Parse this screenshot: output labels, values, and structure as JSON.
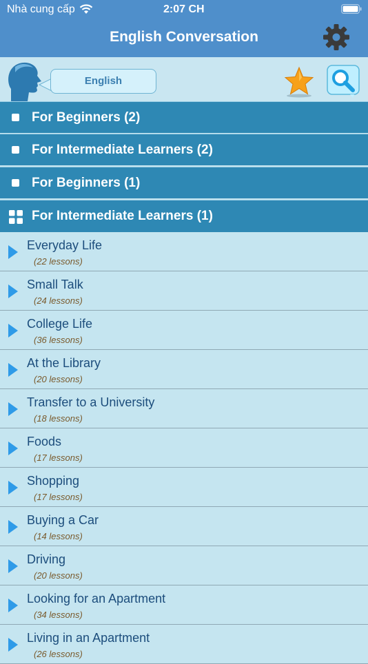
{
  "status_bar": {
    "carrier": "Nhà cung cấp",
    "time": "2:07 CH"
  },
  "nav": {
    "title": "English Conversation"
  },
  "header": {
    "language_label": "English"
  },
  "colors": {
    "nav_bar": "#4f8fcb",
    "category_bar": "#2e88b4",
    "list_background": "#c5e5f0",
    "lesson_title": "#1c4d7c",
    "lesson_count": "#7a5a2c",
    "arrow": "#2f9be8"
  },
  "categories": [
    {
      "label": "For Beginners (2)",
      "icon": "checkbox-icon"
    },
    {
      "label": "For Intermediate Learners (2)",
      "icon": "checkbox-icon"
    },
    {
      "label": "For Beginners (1)",
      "icon": "checkbox-icon"
    },
    {
      "label": "For Intermediate Learners (1)",
      "icon": "grid-icon"
    }
  ],
  "lessons": [
    {
      "title": "Everyday Life",
      "count": "(22 lessons)"
    },
    {
      "title": "Small Talk",
      "count": "(24 lessons)"
    },
    {
      "title": "College Life",
      "count": "(36 lessons)"
    },
    {
      "title": "At the Library",
      "count": "(20 lessons)"
    },
    {
      "title": "Transfer to a University",
      "count": "(18 lessons)"
    },
    {
      "title": "Foods",
      "count": "(17 lessons)"
    },
    {
      "title": "Shopping",
      "count": "(17 lessons)"
    },
    {
      "title": "Buying a Car",
      "count": "(14 lessons)"
    },
    {
      "title": "Driving",
      "count": "(20 lessons)"
    },
    {
      "title": "Looking for an Apartment",
      "count": "(34 lessons)"
    },
    {
      "title": "Living in an Apartment",
      "count": "(26 lessons)"
    }
  ]
}
